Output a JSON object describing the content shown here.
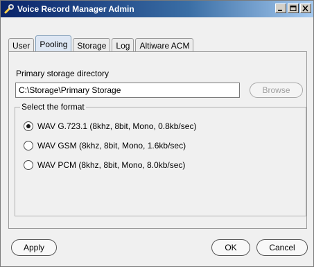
{
  "window": {
    "title": "Voice Record Manager Admin",
    "icon": "wrench-icon",
    "caption_buttons": [
      "minimize-icon",
      "maximize-icon",
      "close-icon"
    ]
  },
  "tabs": [
    {
      "label": "User",
      "active": false
    },
    {
      "label": "Pooling",
      "active": true
    },
    {
      "label": "Storage",
      "active": false
    },
    {
      "label": "Log",
      "active": false
    },
    {
      "label": "Altiware ACM",
      "active": false
    }
  ],
  "storage": {
    "label": "Primary storage directory",
    "value": "C:\\Storage\\Primary Storage",
    "browse_label": "Browse"
  },
  "format": {
    "legend": "Select the format",
    "options": [
      {
        "label": "WAV G.723.1 (8khz, 8bit, Mono, 0.8kb/sec)",
        "checked": true
      },
      {
        "label": "WAV GSM (8khz, 8bit, Mono, 1.6kb/sec)",
        "checked": false
      },
      {
        "label": "WAV PCM (8khz, 8bit, Mono, 8.0kb/sec)",
        "checked": false
      }
    ]
  },
  "footer": {
    "apply_label": "Apply",
    "ok_label": "OK",
    "cancel_label": "Cancel"
  }
}
